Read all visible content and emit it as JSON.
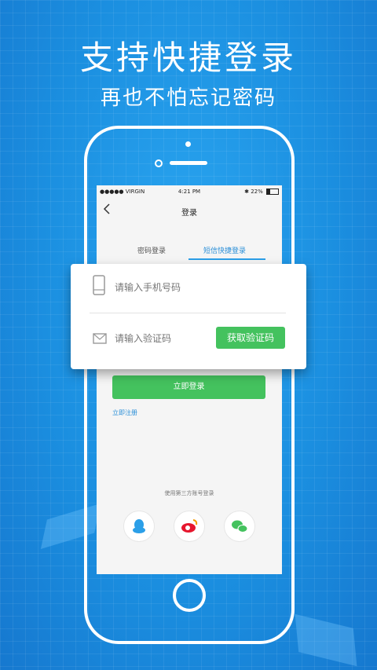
{
  "promo": {
    "headline": "支持快捷登录",
    "subline": "再也不怕忘记密码"
  },
  "status_bar": {
    "carrier": "●●●●● VIRGIN",
    "time": "4:21 PM",
    "battery": "22%"
  },
  "nav": {
    "back_icon": "chevron-left-icon",
    "title": "登录"
  },
  "tabs": [
    {
      "label": "密码登录",
      "active": false
    },
    {
      "label": "短信快捷登录",
      "active": true
    }
  ],
  "form": {
    "phone_placeholder": "请输入手机号码",
    "code_placeholder": "请输入验证码",
    "get_code_label": "获取验证码"
  },
  "actions": {
    "login_label": "立即登录",
    "register_label": "立即注册"
  },
  "third_party": {
    "caption": "使用第三方账号登录",
    "providers": [
      "qq-icon",
      "weibo-icon",
      "wechat-icon"
    ]
  },
  "colors": {
    "accent_green": "#44c25e",
    "accent_blue": "#2b8fd8",
    "background": "#1e95e4"
  }
}
